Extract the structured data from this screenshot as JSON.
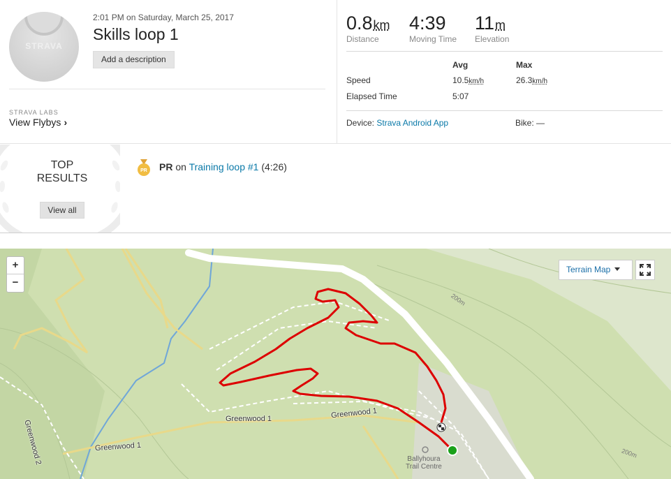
{
  "activity": {
    "date": "2:01 PM on Saturday, March 25, 2017",
    "title": "Skills loop 1",
    "add_description": "Add a description",
    "avatar_text": "STRAVA"
  },
  "labs": {
    "label": "STRAVA LABS",
    "flyby": "View Flybys",
    "flyby_chevron": "›"
  },
  "stats": {
    "distance": {
      "value": "0.8",
      "unit": "km",
      "label": "Distance"
    },
    "moving_time": {
      "value": "4:39",
      "label": "Moving Time"
    },
    "elevation": {
      "value": "11",
      "unit": "m",
      "label": "Elevation"
    }
  },
  "details": {
    "avg_header": "Avg",
    "max_header": "Max",
    "speed_label": "Speed",
    "speed_avg": "10.5",
    "speed_max": "26.3",
    "speed_unit": "km/h",
    "elapsed_label": "Elapsed Time",
    "elapsed_avg": "5:07",
    "device_label": "Device:",
    "device_value": "Strava Android App",
    "bike_label": "Bike:",
    "bike_value": "—"
  },
  "top_results": {
    "title_line1": "TOP",
    "title_line2": "RESULTS",
    "view_all": "View all",
    "pr_badge": "PR",
    "pr_prefix": "PR",
    "pr_on": "on",
    "segment": "Training loop #1",
    "time": "(4:26)"
  },
  "map": {
    "zoom_in": "+",
    "zoom_out": "−",
    "map_type": "Terrain Map",
    "labels": {
      "greenwood1_a": "Greenwood 1",
      "greenwood1_b": "Greenwood 1",
      "greenwood1_c": "Greenwood 1",
      "greenwood2": "Greenwood 2",
      "contour_a": "200m",
      "contour_b": "200m",
      "poi_line1": "Ballyhoura",
      "poi_line2": "Trail Centre"
    }
  },
  "colors": {
    "route": "#dd0000",
    "link": "#0a79a8",
    "map_bg": "#cfdfb0",
    "start_marker": "#1aa11a"
  }
}
